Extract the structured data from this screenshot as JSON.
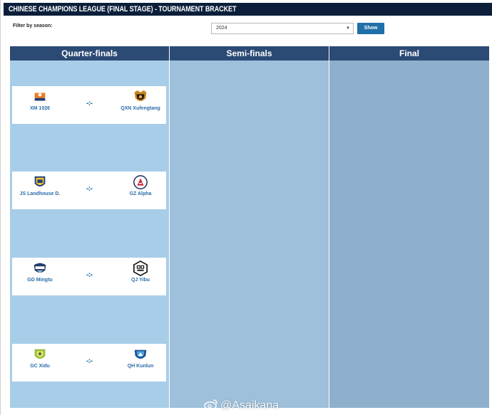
{
  "page": {
    "title": "CHINESE CHAMPIONS LEAGUE (FINAL STAGE) - TOURNAMENT BRACKET"
  },
  "filter": {
    "label": "Filter by season:",
    "selected": "2024",
    "show_label": "Show"
  },
  "rounds": [
    {
      "label": "Quarter-finals"
    },
    {
      "label": "Semi-finals"
    },
    {
      "label": "Final"
    }
  ],
  "matches": [
    {
      "home": {
        "name": "XM 1026",
        "badge": "xm-1026-crest"
      },
      "score": "-:-",
      "away": {
        "name": "QXN Xufengtang",
        "badge": "qxn-xufengtang-crest"
      }
    },
    {
      "home": {
        "name": "JS Landhouse D.",
        "badge": "js-landhouse-crest"
      },
      "score": "-:-",
      "away": {
        "name": "GZ Alpha",
        "badge": "gz-alpha-crest"
      }
    },
    {
      "home": {
        "name": "GD Mingtu",
        "badge": "gd-mingtu-crest"
      },
      "score": "-:-",
      "away": {
        "name": "QJ Yibu",
        "badge": "qj-yibu-crest"
      }
    },
    {
      "home": {
        "name": "GC Xidu",
        "badge": "gc-xidu-crest"
      },
      "score": "-:-",
      "away": {
        "name": "QH Kunlun",
        "badge": "qh-kunlun-crest"
      }
    }
  ],
  "watermark": {
    "text": "@Asaikana"
  },
  "colors": {
    "title_bar": "#0b1f3a",
    "column_header": "#2b4a74",
    "quarter_bg": "#a8cde8",
    "semi_bg": "#9ec0db",
    "final_bg": "#8eb0cc",
    "team_link": "#2a6da8",
    "button": "#1f6fa8"
  }
}
